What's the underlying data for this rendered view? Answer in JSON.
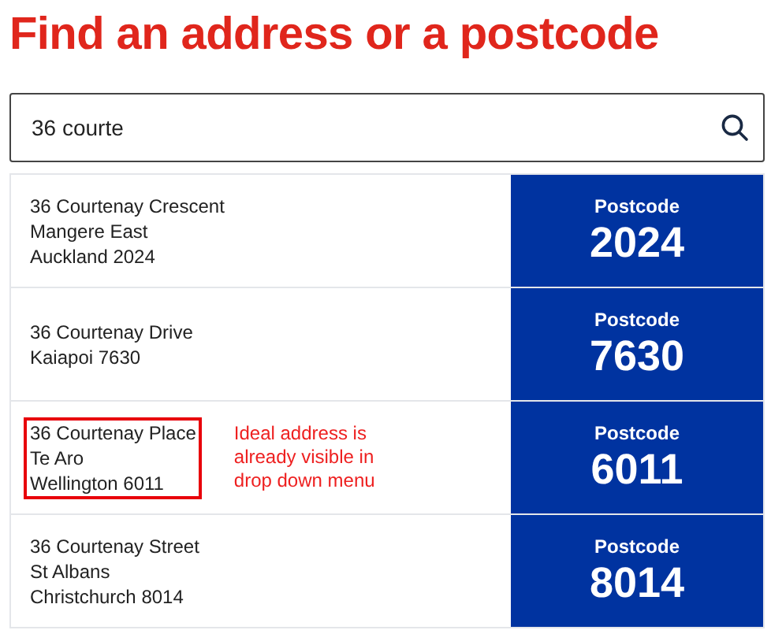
{
  "heading": "Find an address or a postcode",
  "search": {
    "value": "36 courte"
  },
  "results": [
    {
      "address_lines": [
        "36 Courtenay Crescent",
        "Mangere East",
        "Auckland 2024"
      ],
      "postcode_label": "Postcode",
      "postcode": "2024",
      "highlighted": false
    },
    {
      "address_lines": [
        "36 Courtenay Drive",
        "Kaiapoi 7630"
      ],
      "postcode_label": "Postcode",
      "postcode": "7630",
      "highlighted": false
    },
    {
      "address_lines": [
        "36 Courtenay Place",
        "Te Aro",
        "Wellington 6011"
      ],
      "postcode_label": "Postcode",
      "postcode": "6011",
      "highlighted": true,
      "note": "Ideal address is already visible in drop down menu"
    },
    {
      "address_lines": [
        "36 Courtenay Street",
        "St Albans",
        "Christchurch 8014"
      ],
      "postcode_label": "Postcode",
      "postcode": "8014",
      "highlighted": false
    }
  ]
}
